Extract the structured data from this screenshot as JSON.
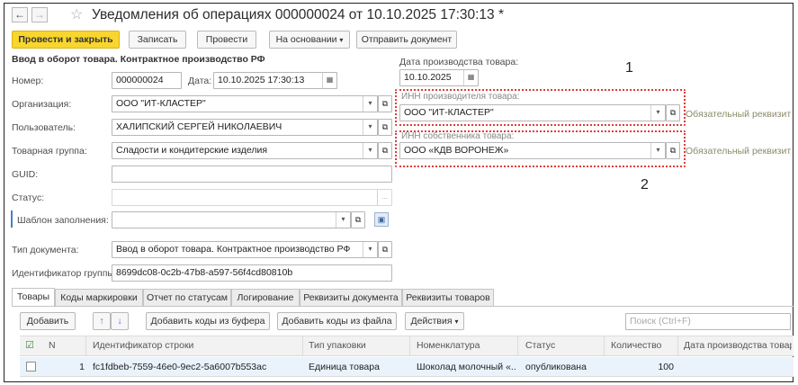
{
  "window": {
    "title": "Уведомления об операциях 000000024 от 10.10.2025 17:30:13 *"
  },
  "toolbar": {
    "post_close": "Провести и закрыть",
    "save": "Записать",
    "post": "Провести",
    "based_on": "На основании",
    "send": "Отправить документ"
  },
  "form": {
    "heading": "Ввод в оборот товара. Контрактное производство РФ",
    "number_label": "Номер:",
    "number": "000000024",
    "date_label": "Дата:",
    "date": "10.10.2025 17:30:13",
    "org_label": "Организация:",
    "org": "ООО \"ИТ-КЛАСТЕР\"",
    "user_label": "Пользователь:",
    "user": "ХАЛИПСКИЙ СЕРГЕЙ НИКОЛАЕВИЧ",
    "group_label": "Товарная группа:",
    "group": "Сладости и кондитерские изделия",
    "guid_label": "GUID:",
    "guid": "",
    "status_label": "Статус:",
    "status": "",
    "template_label": "Шаблон заполнения:",
    "template": "",
    "doctype_label": "Тип документа:",
    "doctype": "Ввод в оборот товара. Контрактное производство РФ",
    "groupid_label": "Идентификатор группы:",
    "groupid": "8699dc08-0c2b-47b8-a597-56f4cd80810b"
  },
  "right": {
    "prod_date_label": "Дата производства товара:",
    "prod_date": "10.10.2025",
    "inn_maker_label": "ИНН производителя товара:",
    "inn_maker": "ООО \"ИТ-КЛАСТЕР\"",
    "inn_owner_label": "ИНН собственника товара:",
    "inn_owner": "ООО «КДВ ВОРОНЕЖ»",
    "required_1": "Обязательный реквизит",
    "required_2": "Обязательный реквизит",
    "marker_1": "1",
    "marker_2": "2"
  },
  "tabs": [
    "Товары",
    "Коды маркировки",
    "Отчет по статусам",
    "Логирование",
    "Реквизиты документа",
    "Реквизиты товаров"
  ],
  "table_toolbar": {
    "add": "Добавить",
    "add_from_buffer": "Добавить коды из буфера",
    "add_from_file": "Добавить коды из файла",
    "actions": "Действия",
    "search_placeholder": "Поиск (Ctrl+F)"
  },
  "table": {
    "columns": [
      "N",
      "Идентификатор строки",
      "Тип упаковки",
      "Номенклатура",
      "Статус",
      "Количество",
      "Дата производства товара"
    ],
    "rows": [
      {
        "n": "1",
        "id": "fc1fdbeb-7559-46e0-9ec2-5a6007b553ac",
        "pack": "Единица товара",
        "item": "Шоколад молочный «...",
        "status": "опубликована",
        "qty": "100",
        "date": ""
      }
    ]
  },
  "icons": {
    "back": "arrow-left-icon",
    "forward": "arrow-right-icon",
    "favorite": "star-icon",
    "dropdown": "chevron-down-icon",
    "open": "open-form-icon",
    "calendar": "calendar-icon",
    "save_template": "floppy-icon",
    "move_up": "arrow-up-icon",
    "move_down": "arrow-down-icon",
    "check_all": "checkbox-icon"
  },
  "colors": {
    "primary_button": "#f9d62e",
    "highlight_box": "#e23a3a",
    "selected_row": "#eaf3fb"
  }
}
